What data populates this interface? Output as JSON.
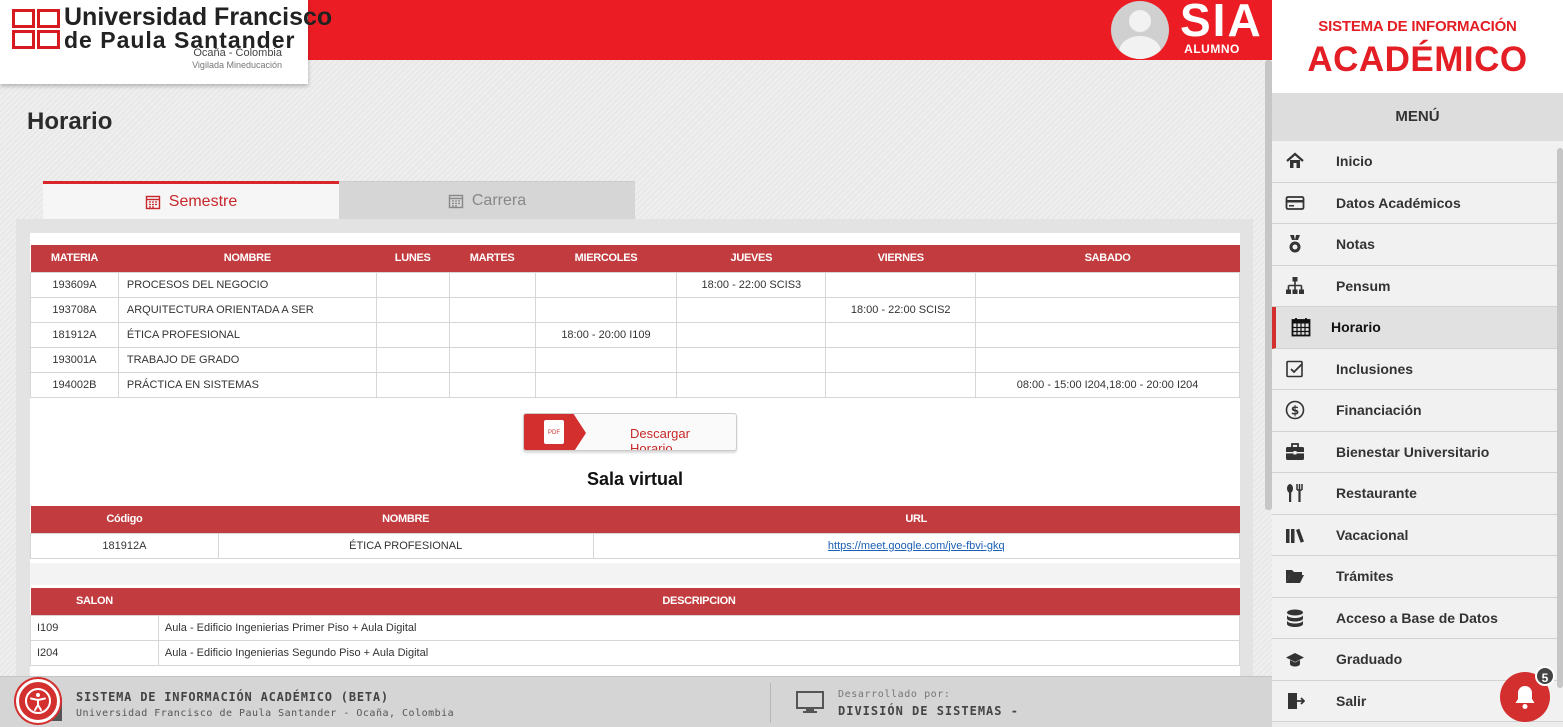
{
  "header": {
    "university_line1": "Universidad Francisco",
    "university_line2": "de Paula Santander",
    "location": "Ocaña - Colombia",
    "vigilada": "Vigilada Mineducación",
    "sia_title": "SIA",
    "sia_subtitle": "ALUMNO"
  },
  "page": {
    "title": "Horario",
    "tabs": [
      {
        "label": "Semestre",
        "icon": "calendar-icon",
        "active": true
      },
      {
        "label": "Carrera",
        "icon": "calendar-icon",
        "active": false
      }
    ]
  },
  "schedule": {
    "headers": [
      "MATERIA",
      "NOMBRE",
      "LUNES",
      "MARTES",
      "MIERCOLES",
      "JUEVES",
      "VIERNES",
      "SABADO"
    ],
    "rows": [
      [
        "193609A",
        "PROCESOS DEL NEGOCIO",
        "",
        "",
        "",
        "18:00 - 22:00 SCIS3",
        "",
        ""
      ],
      [
        "193708A",
        "ARQUITECTURA ORIENTADA A SER",
        "",
        "",
        "",
        "",
        "18:00 - 22:00 SCIS2",
        ""
      ],
      [
        "181912A",
        "ÉTICA PROFESIONAL",
        "",
        "",
        "18:00 - 20:00 I109",
        "",
        "",
        ""
      ],
      [
        "193001A",
        "TRABAJO DE GRADO",
        "",
        "",
        "",
        "",
        "",
        ""
      ],
      [
        "194002B",
        "PRÁCTICA EN SISTEMAS",
        "",
        "",
        "",
        "",
        "",
        "08:00 - 15:00 I204,18:00 - 20:00 I204"
      ]
    ]
  },
  "download": {
    "label": "Descargar Horario",
    "icon_text": "PDF"
  },
  "virtual_room": {
    "title": "Sala virtual",
    "headers": [
      "Código",
      "NOMBRE",
      "URL"
    ],
    "rows": [
      [
        "181912A",
        "ÉTICA PROFESIONAL",
        "https://meet.google.com/jve-fbvi-gkq"
      ]
    ]
  },
  "rooms": {
    "headers": [
      "SALON",
      "DESCRIPCION"
    ],
    "rows": [
      [
        "I109",
        "Aula - Edificio Ingenierias Primer Piso + Aula Digital"
      ],
      [
        "I204",
        "Aula - Edificio Ingenierias Segundo Piso + Aula Digital"
      ]
    ]
  },
  "footer": {
    "title": "SISTEMA DE INFORMACIÓN ACADÉMICO (BETA)",
    "subtitle": "Universidad Francisco de Paula Santander - Ocaña, Colombia",
    "dev_label": "Desarrollado por:",
    "dev_name": "DIVISIÓN DE SISTEMAS -"
  },
  "sidebar": {
    "title_line1": "SISTEMA DE INFORMACIÓN",
    "title_line2": "ACADÉMICO",
    "menu_header": "MENÚ",
    "items": [
      {
        "label": "Inicio",
        "icon": "home-icon"
      },
      {
        "label": "Datos Académicos",
        "icon": "card-icon"
      },
      {
        "label": "Notas",
        "icon": "medal-icon"
      },
      {
        "label": "Pensum",
        "icon": "sitemap-icon"
      },
      {
        "label": "Horario",
        "icon": "calendar-icon",
        "active": true
      },
      {
        "label": "Inclusiones",
        "icon": "checkbox-icon"
      },
      {
        "label": "Financiación",
        "icon": "dollar-icon"
      },
      {
        "label": "Bienestar Universitario",
        "icon": "briefcase-icon"
      },
      {
        "label": "Restaurante",
        "icon": "utensils-icon"
      },
      {
        "label": "Vacacional",
        "icon": "books-icon"
      },
      {
        "label": "Trámites",
        "icon": "folder-icon"
      },
      {
        "label": "Acceso a Base de Datos",
        "icon": "database-icon"
      },
      {
        "label": "Graduado",
        "icon": "graduation-cap-icon"
      },
      {
        "label": "Salir",
        "icon": "logout-icon"
      }
    ]
  },
  "notifications": {
    "count": "5"
  },
  "colors": {
    "brand_red": "#ec1c24",
    "table_header": "#c23b3e",
    "accent": "#d32f2f"
  }
}
